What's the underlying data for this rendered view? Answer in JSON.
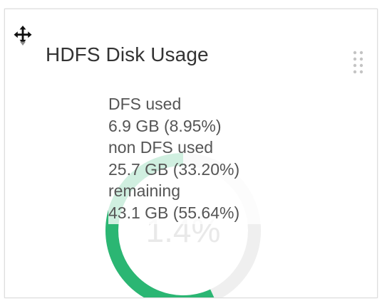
{
  "widget": {
    "title": "HDFS Disk Usage",
    "move_icon": "move-arrows-icon",
    "menu_icon": "drag-dots-icon",
    "chart_center_label": "1.4%",
    "colors": {
      "title": "#333333",
      "text": "#555555",
      "dfs_used": "#e8e8e8",
      "non_dfs_used": "#efefef",
      "remaining": "#2bb673"
    }
  },
  "tooltip": {
    "dfs_used_label": "DFS used",
    "dfs_used_value": "6.9 GB (8.95%)",
    "non_dfs_used_label": "non DFS used",
    "non_dfs_used_value": "25.7 GB (33.20%)",
    "remaining_label": "remaining",
    "remaining_value": "43.1 GB (55.64%)"
  },
  "chart_data": {
    "type": "pie",
    "categories": [
      "DFS used",
      "non DFS used",
      "remaining"
    ],
    "values": [
      8.95,
      33.2,
      55.64
    ],
    "absolute_values": [
      "6.9 GB",
      "25.7 GB",
      "43.1 GB"
    ]
  }
}
